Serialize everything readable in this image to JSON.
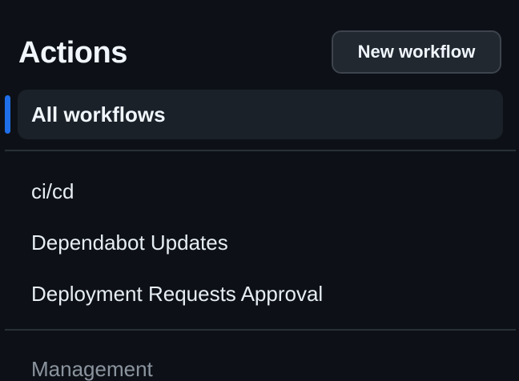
{
  "header": {
    "title": "Actions",
    "new_workflow_label": "New workflow"
  },
  "nav": {
    "selected_label": "All workflows",
    "accent_color": "#1f6feb"
  },
  "workflows": [
    {
      "label": "ci/cd"
    },
    {
      "label": "Dependabot Updates"
    },
    {
      "label": "Deployment Requests Approval"
    }
  ],
  "management": {
    "heading": "Management"
  }
}
